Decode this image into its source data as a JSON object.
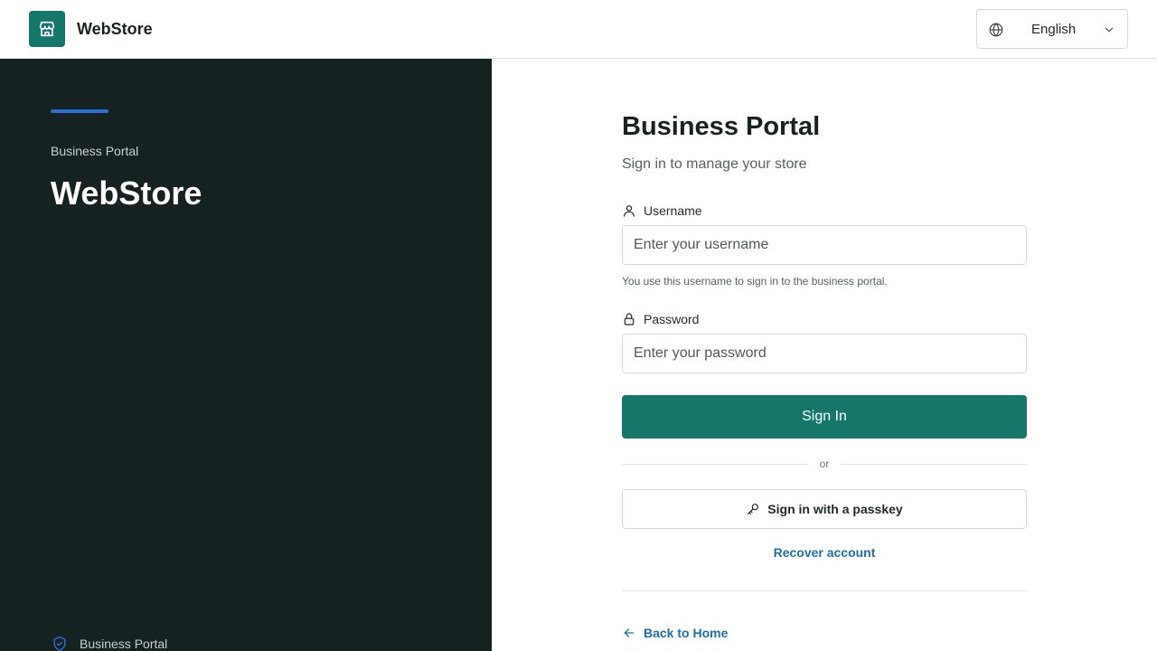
{
  "header": {
    "brand": "WebStore",
    "logo_icon": "storefront-icon",
    "language": {
      "icon": "globe-icon",
      "selected": "English",
      "chevron_icon": "chevron-down-icon"
    }
  },
  "hero": {
    "eyebrow": "Business Portal",
    "title": "WebStore",
    "footer_icon": "shield-icon",
    "footer_label": "Business Portal"
  },
  "login": {
    "title": "Business Portal",
    "subtitle": "Sign in to manage your store",
    "username": {
      "icon": "user-icon",
      "label": "Username",
      "placeholder": "Enter your username",
      "value": "",
      "hint": "You use this username to sign in to the business portal."
    },
    "password": {
      "icon": "lock-icon",
      "label": "Password",
      "placeholder": "Enter your password",
      "value": ""
    },
    "signin_label": "Sign In",
    "divider_label": "or",
    "passkey": {
      "icon": "key-icon",
      "label": "Sign in with a passkey"
    },
    "recover_label": "Recover account",
    "back": {
      "icon": "arrow-left-icon",
      "label": "Back to Home"
    }
  },
  "colors": {
    "primary": "#14776a",
    "dark_panel": "#162222",
    "accent_blue": "#2a6fd6",
    "link": "#1f6fa8"
  }
}
